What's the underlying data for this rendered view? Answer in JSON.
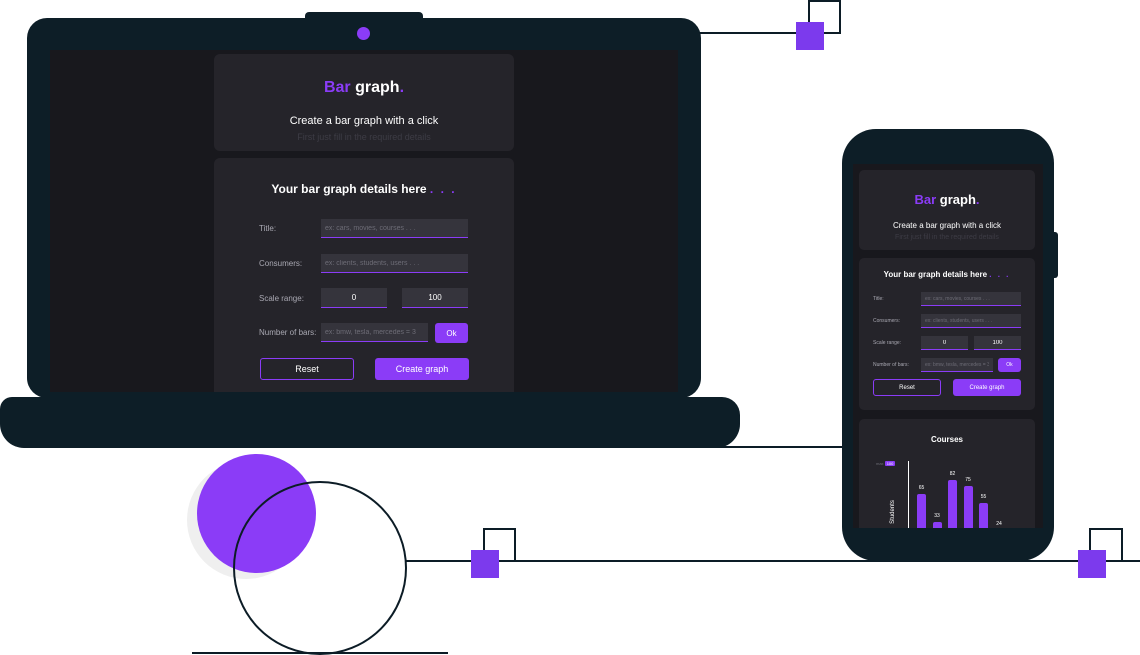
{
  "app": {
    "logo_part1": "Bar",
    "logo_part2": "graph",
    "logo_dot": ".",
    "tagline": "Create a bar graph with a click",
    "subtitle": "First just fill in the required details"
  },
  "form": {
    "title": "Your bar graph details here",
    "title_dots": ". . .",
    "title_label": "Title:",
    "title_placeholder": "ex: cars, movies, courses . . .",
    "title_placeholder_mobile": "ex: cars, movies, courses . . .",
    "consumers_label": "Consumers:",
    "consumers_placeholder": "ex: clients, students, users . . .",
    "consumers_placeholder_mobile": "ex: clients, students, users . . .",
    "scale_label": "Scale range:",
    "scale_min": "0",
    "scale_max": "100",
    "bars_label": "Number of bars:",
    "bars_placeholder": "ex: bmw, tesla, mercedes = 3",
    "bars_placeholder_mobile": "ex: bmw, tesla, mercedes = 3",
    "ok_label": "Ok",
    "reset_label": "Reset",
    "create_label": "Create graph"
  },
  "chart_data": {
    "type": "bar",
    "title": "Courses",
    "ylabel": "Students",
    "max_tag_label": "max",
    "max_tag_value": "100",
    "ylim": [
      0,
      100
    ],
    "values": [
      65,
      33,
      82,
      75,
      55,
      24
    ],
    "value_labels": [
      "65",
      "33",
      "82",
      "75",
      "55",
      "24"
    ]
  },
  "colors": {
    "accent": "#8b3cf7",
    "device": "#0d1e27",
    "screen": "#18181d",
    "card": "#25242a"
  }
}
